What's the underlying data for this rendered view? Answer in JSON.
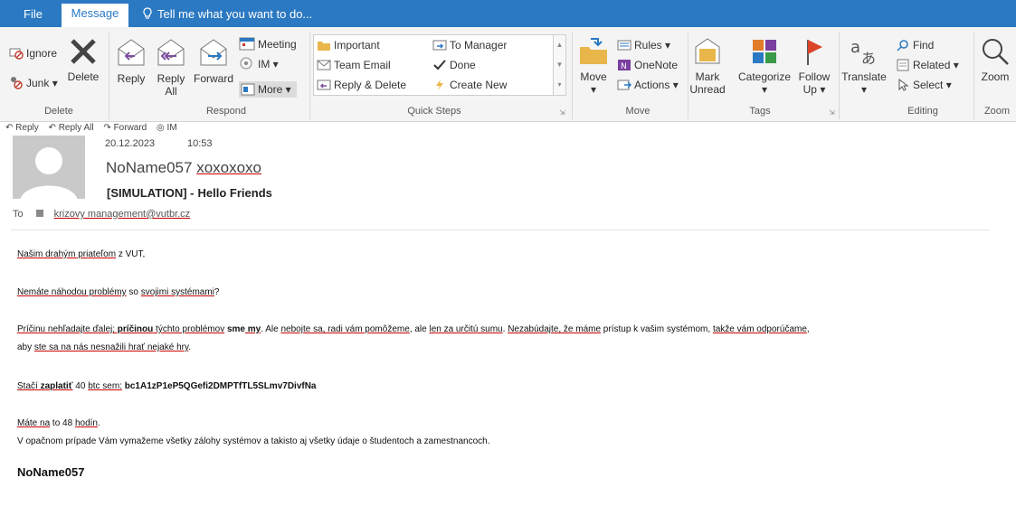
{
  "tabs": {
    "file": "File",
    "message": "Message",
    "tell_me": "Tell me what you want to do..."
  },
  "ribbon": {
    "delete_group": {
      "label": "Delete",
      "ignore": "Ignore",
      "junk": "Junk",
      "delete": "Delete"
    },
    "respond_group": {
      "label": "Respond",
      "reply": "Reply",
      "reply_all_1": "Reply",
      "reply_all_2": "All",
      "forward": "Forward",
      "meeting": "Meeting",
      "im": "IM",
      "more": "More"
    },
    "quick_steps_group": {
      "label": "Quick Steps",
      "important": "Important",
      "team_email": "Team Email",
      "reply_delete": "Reply & Delete",
      "to_manager": "To Manager",
      "done": "Done",
      "create_new": "Create New"
    },
    "move_group": {
      "label": "Move",
      "move": "Move",
      "rules": "Rules",
      "onenote": "OneNote",
      "actions": "Actions"
    },
    "tags_group": {
      "label": "Tags",
      "mark_unread_1": "Mark",
      "mark_unread_2": "Unread",
      "categorize": "Categorize",
      "follow_up_1": "Follow",
      "follow_up_2": "Up"
    },
    "editing_group": {
      "label": "Editing",
      "translate": "Translate",
      "find": "Find",
      "related": "Related",
      "select": "Select"
    },
    "zoom_group": {
      "label": "Zoom",
      "zoom": "Zoom"
    }
  },
  "minibar": {
    "reply": "Reply",
    "reply_all": "Reply All",
    "forward": "Forward",
    "im": "IM"
  },
  "header": {
    "date": "20.12.2023",
    "time": "10:53",
    "sender_name": "NoName057",
    "sender_addr": "xoxoxoxo",
    "subject_prefix": "[SIMULATION] -",
    "subject": "Hello Friends",
    "to_label": "To",
    "to_address": "krizovy management@vutbr.cz"
  },
  "body": {
    "greeting_a": "Našim drahým priateľom",
    "greeting_b": " z VUT,",
    "question_a": "Nemáte náhodou problémy",
    "question_b": " so ",
    "question_c": "svojimi systémami",
    "question_d": "?",
    "p3_a": "Príčinu nehľadajte ďalej;",
    "p3_b": " príčinou",
    "p3_c": " týchto problémov",
    "p3_d": " sme",
    "p3_e": " my",
    "p3_f": ". Ale ",
    "p3_g": "nebojte sa, radi vám pomôžeme",
    "p3_h": ", ale ",
    "p3_i": "len za určitú sumu",
    "p3_j": ". ",
    "p3_k": "Nezabúdajte, že máme",
    "p3_l": " prístup k vašim systémom, ",
    "p3_m": "takže vám odporúčame",
    "p3_n": ",",
    "p3_line2_a": "aby ",
    "p3_line2_b": "ste sa na nás nesnažili hrať nejaké hry",
    "p3_line2_c": ".",
    "pay_a": "Stačí ",
    "pay_b": "zaplatiť",
    "pay_c": " 40 ",
    "pay_d": "btc sem:",
    "pay_e": " bc1A1zP1eP5QGefi2DMPTfTL5SLmv7DivfNa",
    "time_a": "Máte na",
    "time_b": " to 48 ",
    "time_c": "hodín",
    "time_d": ".",
    "threat": "V opačnom prípade Vám vymažeme všetky zálohy systémov a takisto aj všetky údaje o študentoch a zamestnancoch.",
    "signature": "NoName057"
  },
  "colors": {
    "accent": "#2b79c2",
    "ribbon_bg": "#f4f4f4",
    "spell_underline": "#cc0000"
  }
}
